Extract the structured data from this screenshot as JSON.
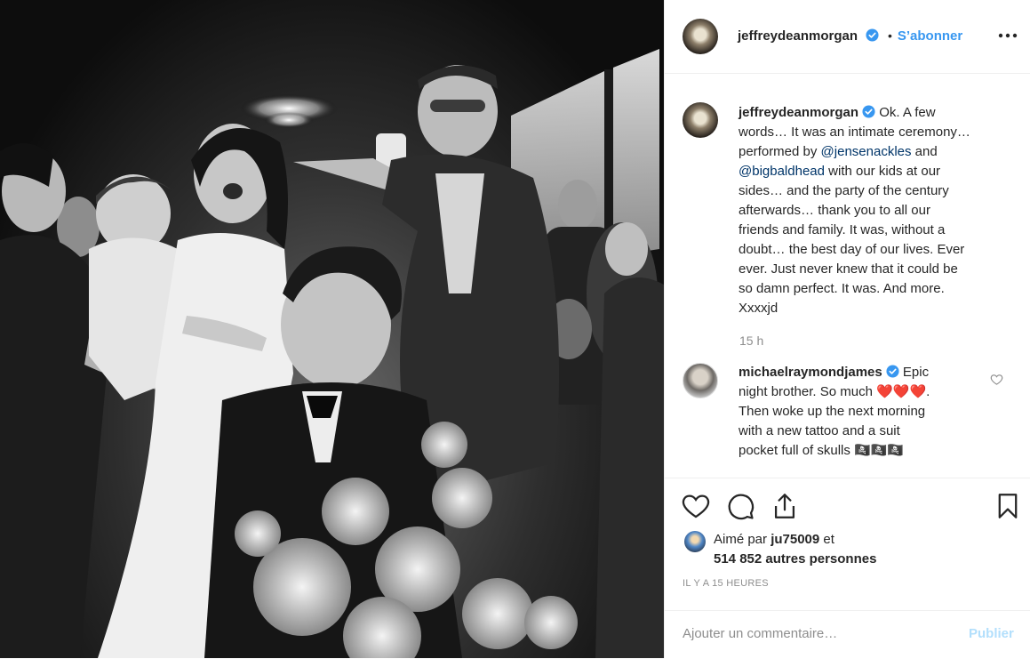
{
  "post": {
    "author": "jeffreydeanmorgan",
    "dot": "•",
    "follow_label": "S’abonner",
    "more_icon": "more-horizontal-icon"
  },
  "caption": {
    "author": "jeffreydeanmorgan",
    "lines": [
      "Ok. A few",
      "words… It was an intimate ceremony…",
      "performed by",
      "@jensenackles",
      "and",
      "@bigbaldhead",
      "with our kids at our",
      "sides… and the party of the century",
      "afterwards… thank you to all our",
      "friends and family. It was, without a",
      "doubt… the best day of our lives. Ever",
      "ever. Just never knew that it could be",
      "so damn perfect. It was. And more.",
      "Xxxxjd"
    ],
    "time": "15 h"
  },
  "comment": {
    "author": "michaelraymondjames",
    "lines": [
      "Epic",
      "night brother. So much",
      "❤️❤️❤️",
      ".",
      "Then woke up the next morning",
      "with a new tattoo and a suit",
      "pocket full of skulls",
      "🏴‍☠️🏴‍☠️🏴‍☠️"
    ]
  },
  "actions": {
    "like_icon": "heart-icon",
    "comment_icon": "comment-icon",
    "share_icon": "share-icon",
    "save_icon": "bookmark-icon"
  },
  "likes": {
    "prefix": "Aimé par",
    "user": "ju75009",
    "suffix": "et",
    "others": "514 852 autres personnes"
  },
  "ago": "IL Y A 15 HEURES",
  "add_comment": {
    "placeholder": "Ajouter un commentaire…",
    "post_label": "Publier"
  },
  "colors": {
    "accent": "#3897f0",
    "verified": "#3897f0",
    "heart": "#ed4956",
    "border": "#efefef"
  }
}
